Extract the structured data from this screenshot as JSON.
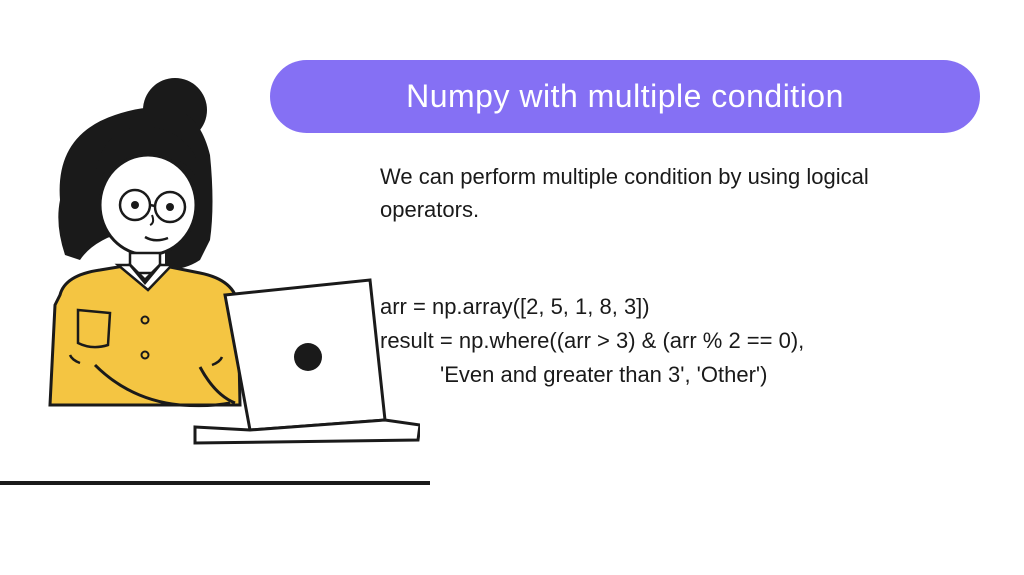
{
  "title": "Numpy with multiple condition",
  "description": "We can perform multiple condition by using logical operators.",
  "code": {
    "line1": "arr = np.array([2, 5, 1, 8, 3])",
    "line2": "result = np.where((arr > 3) & (arr % 2 == 0),",
    "line3": "'Even and greater than 3', 'Other')"
  }
}
